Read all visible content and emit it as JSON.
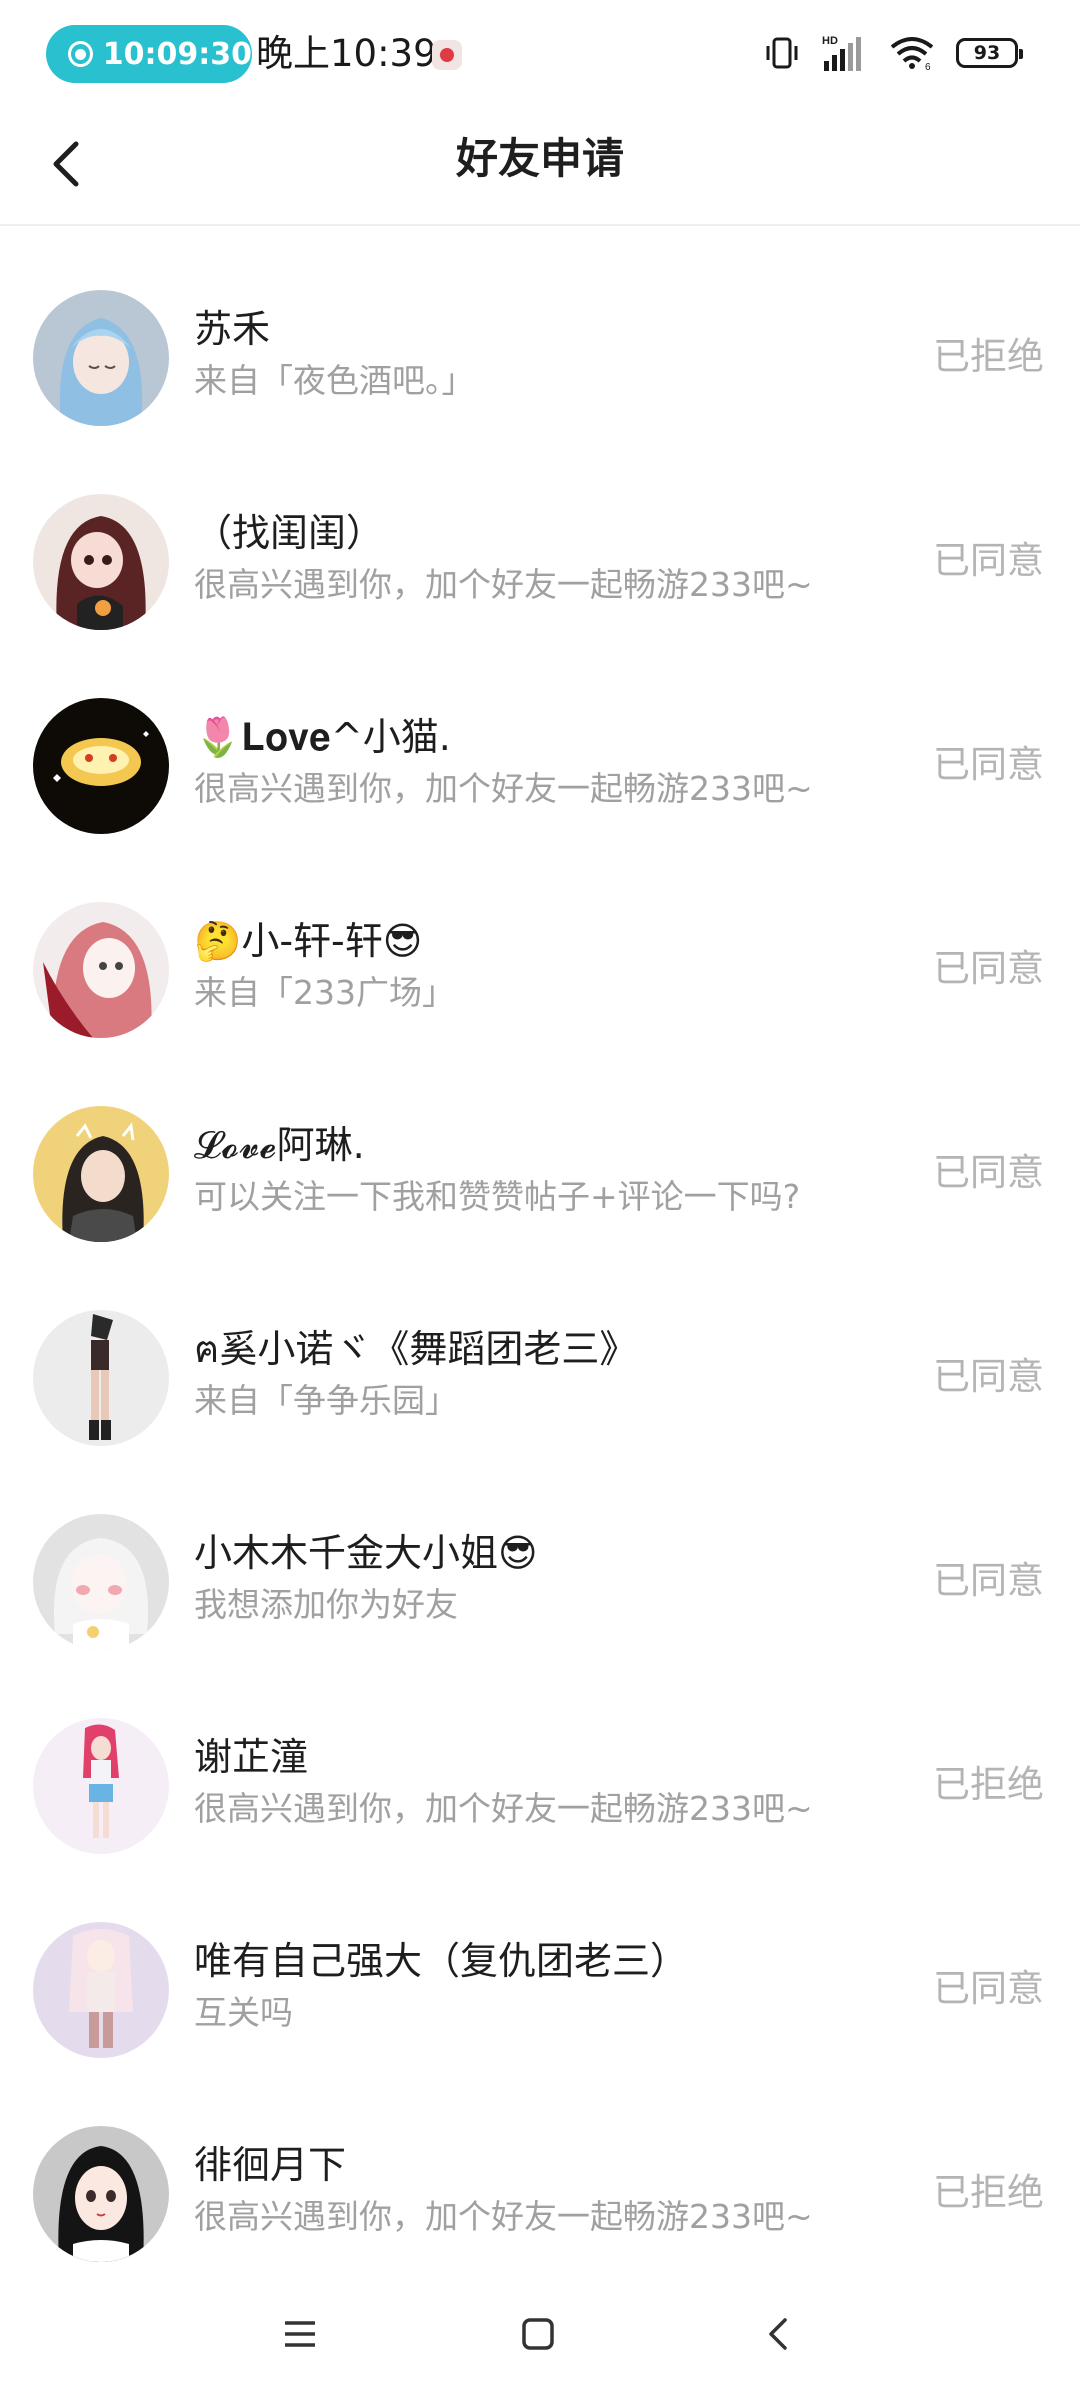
{
  "status_bar": {
    "recording_time": "10:09:30",
    "clock": "晚上10:39",
    "battery": "93",
    "icons": [
      "vibrate-icon",
      "hd-signal-icon",
      "wifi-icon",
      "battery-icon"
    ]
  },
  "header": {
    "title": "好友申请",
    "back_icon": "chevron-left-icon"
  },
  "requests": [
    {
      "name": "苏禾",
      "desc": "来自「夜色酒吧。」",
      "status": "已拒绝",
      "avatar_color": "#9fb8cf"
    },
    {
      "name": "（找闺闺）",
      "desc": "很高兴遇到你，加个好友一起畅游233吧~",
      "status": "已同意",
      "avatar_color": "#6b2b2b"
    },
    {
      "name": "🌷𝐋𝐨𝐯𝐞^小猫.",
      "desc": "很高兴遇到你，加个好友一起畅游233吧~",
      "status": "已同意",
      "avatar_color": "#1a1208"
    },
    {
      "name": "🤔小-轩-轩😎",
      "desc": "来自「233广场」",
      "status": "已同意",
      "avatar_color": "#c04550"
    },
    {
      "name": "𝓛𝓸𝓿𝓮阿琳.",
      "desc": "可以关注一下我和赞赞帖子+评论一下吗?",
      "status": "已同意",
      "avatar_color": "#e8c46a"
    },
    {
      "name": "ฅ奚小诺ヾ《舞蹈团老三》",
      "desc": "来自「争争乐园」",
      "status": "已同意",
      "avatar_color": "#e6e6e6"
    },
    {
      "name": "小木木千金大小姐😎",
      "desc": "我想添加你为好友",
      "status": "已同意",
      "avatar_color": "#dcdcdc"
    },
    {
      "name": "谢芷潼",
      "desc": "很高兴遇到你，加个好友一起畅游233吧~",
      "status": "已拒绝",
      "avatar_color": "#f2e4f4"
    },
    {
      "name": "唯有自己强大（复仇团老三）",
      "desc": "互关吗",
      "status": "已同意",
      "avatar_color": "#e8dcec"
    },
    {
      "name": "徘徊月下",
      "desc": "很高兴遇到你，加个好友一起畅游233吧~",
      "status": "已拒绝",
      "avatar_color": "#bdbdbd"
    }
  ],
  "nav_bar": {
    "icons": [
      "menu-icon",
      "home-square-icon",
      "back-triangle-icon"
    ]
  }
}
